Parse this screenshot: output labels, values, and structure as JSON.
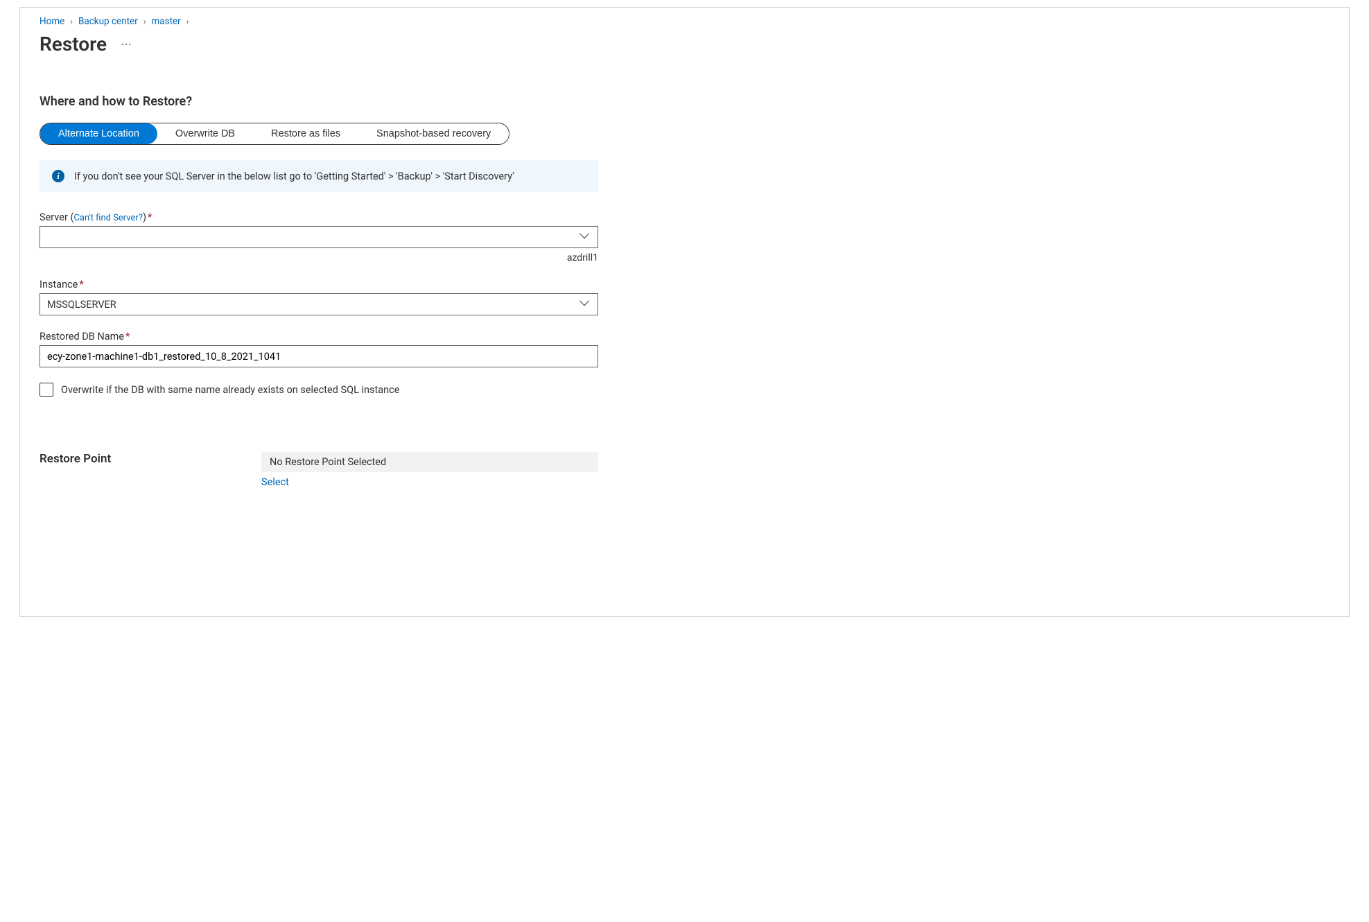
{
  "breadcrumb": {
    "items": [
      {
        "label": "Home"
      },
      {
        "label": "Backup center"
      },
      {
        "label": "master"
      }
    ]
  },
  "page": {
    "title": "Restore",
    "more_label": "⋯"
  },
  "section": {
    "heading": "Where and how to Restore?"
  },
  "tabs": {
    "items": [
      {
        "label": "Alternate Location"
      },
      {
        "label": "Overwrite DB"
      },
      {
        "label": "Restore as files"
      },
      {
        "label": "Snapshot-based recovery"
      }
    ]
  },
  "info": {
    "text": "If you don't see your SQL Server in the below list go to 'Getting Started' > 'Backup' > 'Start Discovery'"
  },
  "form": {
    "server": {
      "label_prefix": "Server (",
      "hint_link": "Can't find Server?",
      "label_suffix": ")",
      "value": "",
      "helper": "azdrill1"
    },
    "instance": {
      "label": "Instance",
      "value": "MSSQLSERVER"
    },
    "dbname": {
      "label": "Restored DB Name",
      "value": "ecy-zone1-machine1-db1_restored_10_8_2021_1041"
    },
    "overwrite_checkbox": {
      "label": "Overwrite if the DB with same name already exists on selected SQL instance"
    }
  },
  "restore_point": {
    "label": "Restore Point",
    "value": "No Restore Point Selected",
    "select_label": "Select"
  }
}
